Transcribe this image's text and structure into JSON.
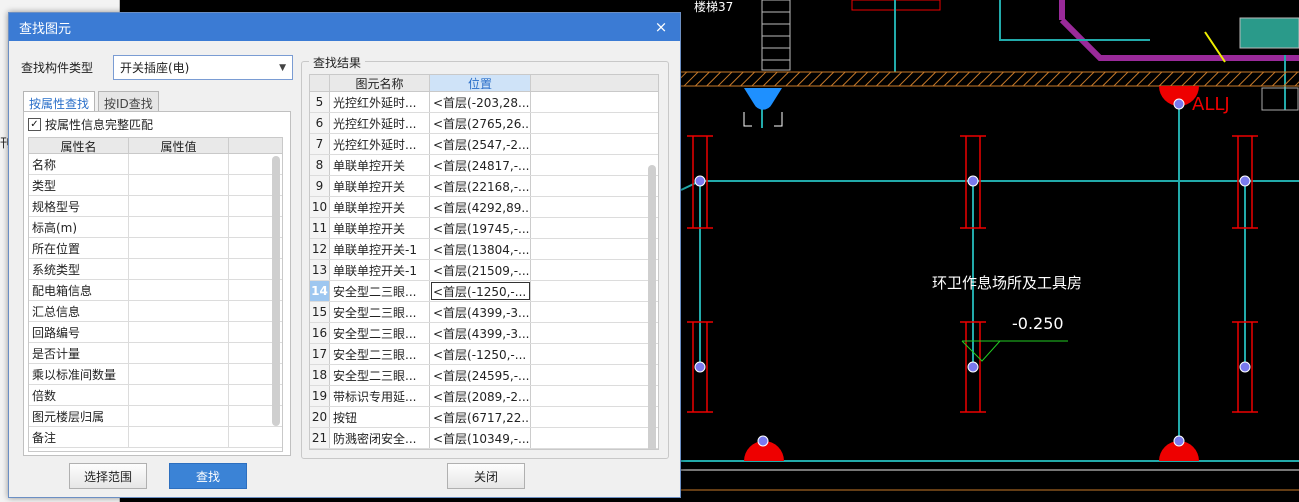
{
  "cad": {
    "label_top": "楼梯37",
    "room_label": "环卫作息场所及工具房",
    "elevation": "-0.250",
    "tag": "ALLJ"
  },
  "app_strip": {
    "side_char": "刊"
  },
  "dialog": {
    "title": "查找图元",
    "close_icon": "×",
    "type_label": "查找构件类型",
    "type_value": "开关插座(电)",
    "tabs": [
      "按属性查找",
      "按ID查找"
    ],
    "match_checkbox": {
      "label": "按属性信息完整匹配",
      "checked": "✓"
    },
    "prop_headers": [
      "属性名",
      "属性值"
    ],
    "props": [
      "名称",
      "类型",
      "规格型号",
      "标高(m)",
      "所在位置",
      "系统类型",
      "配电箱信息",
      "汇总信息",
      "回路编号",
      "是否计量",
      "乘以标准间数量",
      "倍数",
      "图元楼层归属",
      "备注"
    ],
    "results_legend": "查找结果",
    "result_headers": [
      "图元名称",
      "位置"
    ],
    "results": [
      {
        "idx": "5",
        "name": "光控红外延时...",
        "pos": "<首层(-203,28..."
      },
      {
        "idx": "6",
        "name": "光控红外延时...",
        "pos": "<首层(2765,26..."
      },
      {
        "idx": "7",
        "name": "光控红外延时...",
        "pos": "<首层(2547,-2..."
      },
      {
        "idx": "8",
        "name": "单联单控开关",
        "pos": "<首层(24817,-..."
      },
      {
        "idx": "9",
        "name": "单联单控开关",
        "pos": "<首层(22168,-..."
      },
      {
        "idx": "10",
        "name": "单联单控开关",
        "pos": "<首层(4292,89..."
      },
      {
        "idx": "11",
        "name": "单联单控开关",
        "pos": "<首层(19745,-..."
      },
      {
        "idx": "12",
        "name": "单联单控开关-1",
        "pos": "<首层(13804,-..."
      },
      {
        "idx": "13",
        "name": "单联单控开关-1",
        "pos": "<首层(21509,-..."
      },
      {
        "idx": "14",
        "name": "安全型二三眼...",
        "pos": "<首层(-1250,-..."
      },
      {
        "idx": "15",
        "name": "安全型二三眼...",
        "pos": "<首层(4399,-3..."
      },
      {
        "idx": "16",
        "name": "安全型二三眼...",
        "pos": "<首层(4399,-3..."
      },
      {
        "idx": "17",
        "name": "安全型二三眼...",
        "pos": "<首层(-1250,-..."
      },
      {
        "idx": "18",
        "name": "安全型二三眼...",
        "pos": "<首层(24595,-..."
      },
      {
        "idx": "19",
        "name": "带标识专用延...",
        "pos": "<首层(2089,-2..."
      },
      {
        "idx": "20",
        "name": "按钮",
        "pos": "<首层(6717,22..."
      },
      {
        "idx": "21",
        "name": "防溅密闭安全...",
        "pos": "<首层(10349,-..."
      }
    ],
    "selected_idx": "14",
    "buttons": {
      "select_range": "选择范围",
      "find": "查找",
      "close": "关闭"
    }
  }
}
